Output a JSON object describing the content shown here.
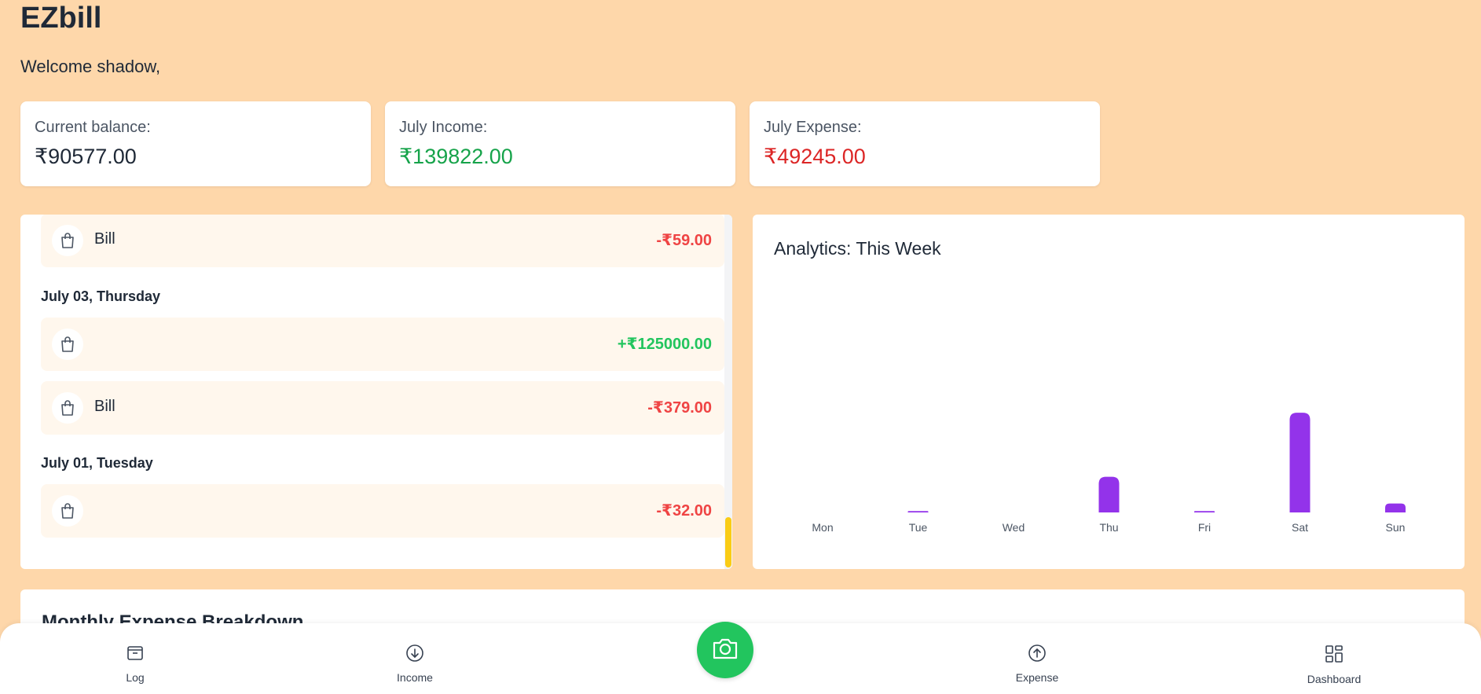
{
  "app": {
    "title": "EZbill",
    "welcome": "Welcome shadow,"
  },
  "stats": [
    {
      "label": "Current balance:",
      "value": "₹90577.00",
      "color": "#1f2937"
    },
    {
      "label": "July Income:",
      "value": "₹139822.00",
      "color": "#16a34a"
    },
    {
      "label": "July Expense:",
      "value": "₹49245.00",
      "color": "#dc2626"
    }
  ],
  "transactions": {
    "rows": [
      {
        "name": "Bill",
        "amount": "-₹59.00"
      },
      {
        "name": "",
        "amount": "+₹125000.00"
      },
      {
        "name": "Bill",
        "amount": "-₹379.00"
      },
      {
        "name": "",
        "amount": "-₹32.00"
      }
    ],
    "days": [
      "July 03, Thursday",
      "July 01, Tuesday"
    ]
  },
  "analytics": {
    "title": "Analytics: This Week"
  },
  "chart_data": {
    "type": "bar",
    "categories": [
      "Mon",
      "Tue",
      "Wed",
      "Thu",
      "Fri",
      "Sat",
      "Sun"
    ],
    "values": [
      0,
      1.5,
      0,
      40,
      1.5,
      112,
      10
    ],
    "ylim": [
      0,
      300
    ],
    "color": "#9333ea",
    "grid": false
  },
  "monthly": {
    "title": "Monthly Expense Breakdown"
  },
  "nav": {
    "log": "Log",
    "income": "Income",
    "expense": "Expense",
    "dashboard": "Dashboard"
  },
  "icons": {
    "bag": "shopping-bag-icon",
    "camera": "camera-icon",
    "log": "wallet-icon",
    "income": "arrow-down-circle-icon",
    "expense": "arrow-up-circle-icon",
    "dashboard": "grid-icon"
  },
  "colors": {
    "background": "#fed7aa",
    "accent": "#22c55e",
    "bar": "#9333ea"
  }
}
